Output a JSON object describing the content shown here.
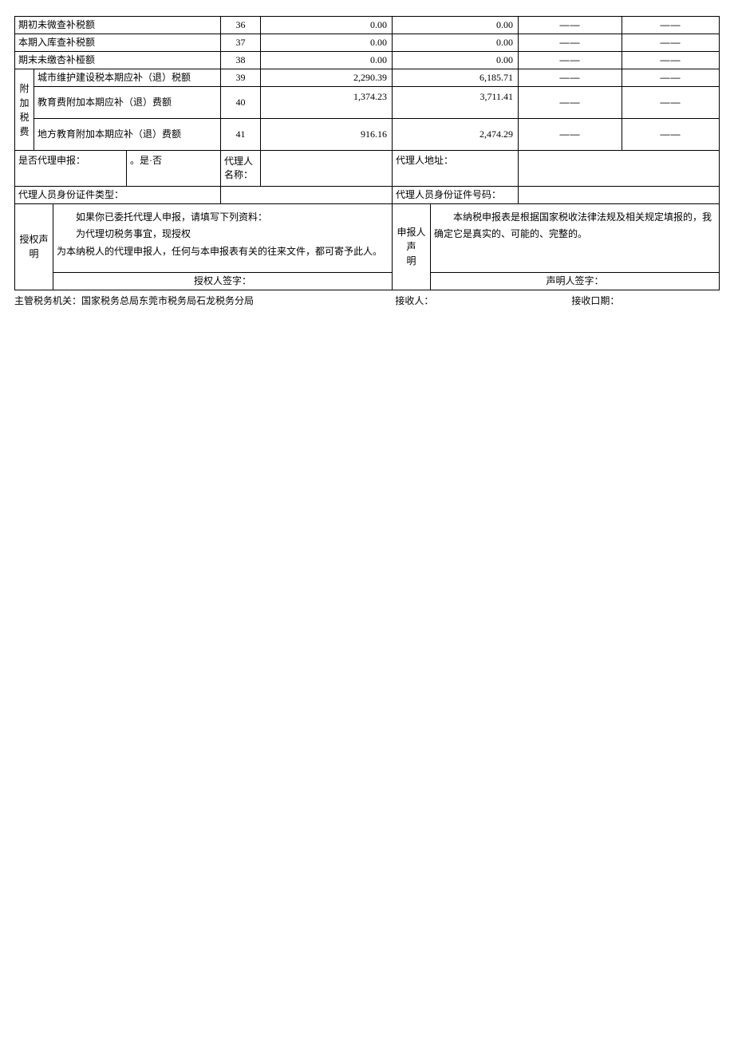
{
  "sideLabel": "附加税费",
  "rows": [
    {
      "name": "期初未微查补税额",
      "no": "36",
      "c1": "0.00",
      "c2": "0.00",
      "c3": "——",
      "c4": "——"
    },
    {
      "name": "本期入库查补税额",
      "no": "37",
      "c1": "0.00",
      "c2": "0.00",
      "c3": "——",
      "c4": "——"
    },
    {
      "name": "期末未缴杏补桠额",
      "no": "38",
      "c1": "0.00",
      "c2": "0.00",
      "c3": "——",
      "c4": "——"
    },
    {
      "name": "城市维护建设税本期应补（退）税额",
      "no": "39",
      "c1": "2,290.39",
      "c2": "6,185.71",
      "c3": "——",
      "c4": "——"
    },
    {
      "name": "教育费附加本期应补（退）费额",
      "no": "40",
      "c1": "1,374.23",
      "c2": "3,711.41",
      "c3": "——",
      "c4": "——"
    },
    {
      "name": "地方教育附加本期应补（退）费额",
      "no": "41",
      "c1": "916.16",
      "c2": "2,474.29",
      "c3": "——",
      "c4": "——"
    }
  ],
  "agent": {
    "isAgentLabel": "是否代理申报：",
    "isAgentValue": "。是·否",
    "nameLabel": "代理人名称：",
    "addrLabel": "代理人地址：",
    "idTypeLabel": "代理人员身份证件类型：",
    "idNoLabel": "代理人员身份证件号码："
  },
  "auth": {
    "leftTitle": "授权声明",
    "line1": "如果你已委托代理人申报，请填写下列资料：",
    "line2": "为代理切税务事宜，现授权",
    "line3": "为本纳税人的代理申报人，任何与本申报表有关的往来文件，都可寄予此人。",
    "leftSign": "授权人签字：",
    "rightTitle": "申报人声明",
    "rightBody": "本纳税申报表是根据国家税收法律法规及相关规定填报的，我确定它是真实的、可能的、完整的。",
    "rightSign": "声明人签字："
  },
  "footer": {
    "orgLabel": "主管税务机关：",
    "orgValue": "国家税务总局东莞市税务局石龙税务分局",
    "recvBy": "接收人：",
    "recvDate": "接收口期："
  }
}
